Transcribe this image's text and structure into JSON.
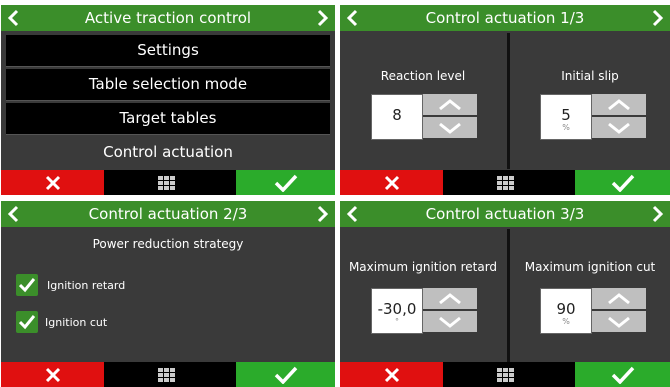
{
  "panel1": {
    "title": "Active traction control",
    "menu": [
      "Settings",
      "Table selection mode",
      "Target tables",
      "Control actuation"
    ],
    "selected_index": 3
  },
  "panel2": {
    "title": "Control actuation 1/3",
    "controls": [
      {
        "label": "Reaction level",
        "value": "8",
        "unit": ""
      },
      {
        "label": "Initial slip",
        "value": "5",
        "unit": "%"
      }
    ]
  },
  "panel3": {
    "title": "Control actuation 2/3",
    "strategy_label": "Power reduction strategy",
    "options": [
      {
        "label": "Ignition retard",
        "checked": true
      },
      {
        "label": "Ignition cut",
        "checked": true
      }
    ]
  },
  "panel4": {
    "title": "Control actuation 3/3",
    "controls": [
      {
        "label": "Maximum ignition retard",
        "value": "-30,0",
        "unit": "°"
      },
      {
        "label": "Maximum ignition cut",
        "value": "90",
        "unit": "%"
      }
    ]
  },
  "colors": {
    "header": "#3b8e2a",
    "cancel": "#e01010",
    "ok": "#2bab2b",
    "panel_bg": "#3a3a3a"
  },
  "icons": {
    "back": "chevron-left-icon",
    "forward": "chevron-right-icon",
    "cancel": "x-icon",
    "menu": "grid-icon",
    "confirm": "check-icon",
    "increase": "chevron-up-icon",
    "decrease": "chevron-down-icon"
  }
}
